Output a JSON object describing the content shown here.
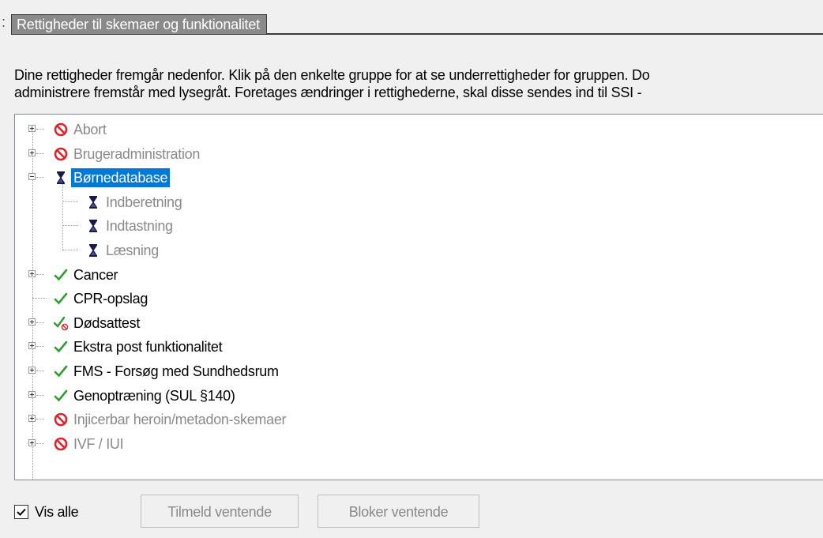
{
  "section": {
    "title": "Rettigheder til skemaer og funktionalitet",
    "colon": ":"
  },
  "description": {
    "line1": "Dine rettigheder fremgår nedenfor. Klik på den enkelte gruppe for at se underrettigheder for gruppen. Do",
    "line2": "administrere fremstår med lysegråt. Foretages ændringer i rettighederne, skal disse sendes ind til SSI -"
  },
  "tree": {
    "items": [
      {
        "label": "Abort",
        "status": "blocked",
        "state": "gray",
        "expander": "collapsed",
        "level": 0
      },
      {
        "label": "Brugeradministration",
        "status": "blocked",
        "state": "gray",
        "expander": "collapsed",
        "level": 0
      },
      {
        "label": "Børnedatabase",
        "status": "pending",
        "state": "selected",
        "expander": "expanded",
        "level": 0
      },
      {
        "label": "Indberetning",
        "status": "pending",
        "state": "gray",
        "expander": "none",
        "level": 1
      },
      {
        "label": "Indtastning",
        "status": "pending",
        "state": "gray",
        "expander": "none",
        "level": 1
      },
      {
        "label": "Læsning",
        "status": "pending",
        "state": "gray",
        "expander": "none",
        "level": 1
      },
      {
        "label": "Cancer",
        "status": "granted",
        "state": "normal",
        "expander": "collapsed",
        "level": 0
      },
      {
        "label": "CPR-opslag",
        "status": "granted",
        "state": "normal",
        "expander": "none",
        "level": 0
      },
      {
        "label": "Dødsattest",
        "status": "partial",
        "state": "normal",
        "expander": "collapsed",
        "level": 0
      },
      {
        "label": "Ekstra post funktionalitet",
        "status": "granted",
        "state": "normal",
        "expander": "collapsed",
        "level": 0
      },
      {
        "label": "FMS - Forsøg med Sundhedsrum",
        "status": "granted",
        "state": "normal",
        "expander": "collapsed",
        "level": 0
      },
      {
        "label": "Genoptræning (SUL §140)",
        "status": "granted",
        "state": "normal",
        "expander": "collapsed",
        "level": 0
      },
      {
        "label": "Injicerbar heroin/metadon-skemaer",
        "status": "blocked",
        "state": "gray",
        "expander": "collapsed",
        "level": 0
      },
      {
        "label": "IVF / IUI",
        "status": "blocked",
        "state": "gray",
        "expander": "collapsed",
        "level": 0
      }
    ]
  },
  "footer": {
    "show_all_label": "Vis alle",
    "show_all_checked": true,
    "enroll_pending_label": "Tilmeld ventende",
    "block_pending_label": "Bloker ventende"
  },
  "colors": {
    "selected": "#0078d7",
    "blocked": "#e0242c",
    "granted": "#2e9e2e",
    "disabled_text": "#8a8a8a"
  },
  "icons": {
    "blocked": "blocked-icon",
    "granted": "checkmark-icon",
    "pending": "hourglass-icon",
    "partial": "checkmark-partial-icon"
  }
}
